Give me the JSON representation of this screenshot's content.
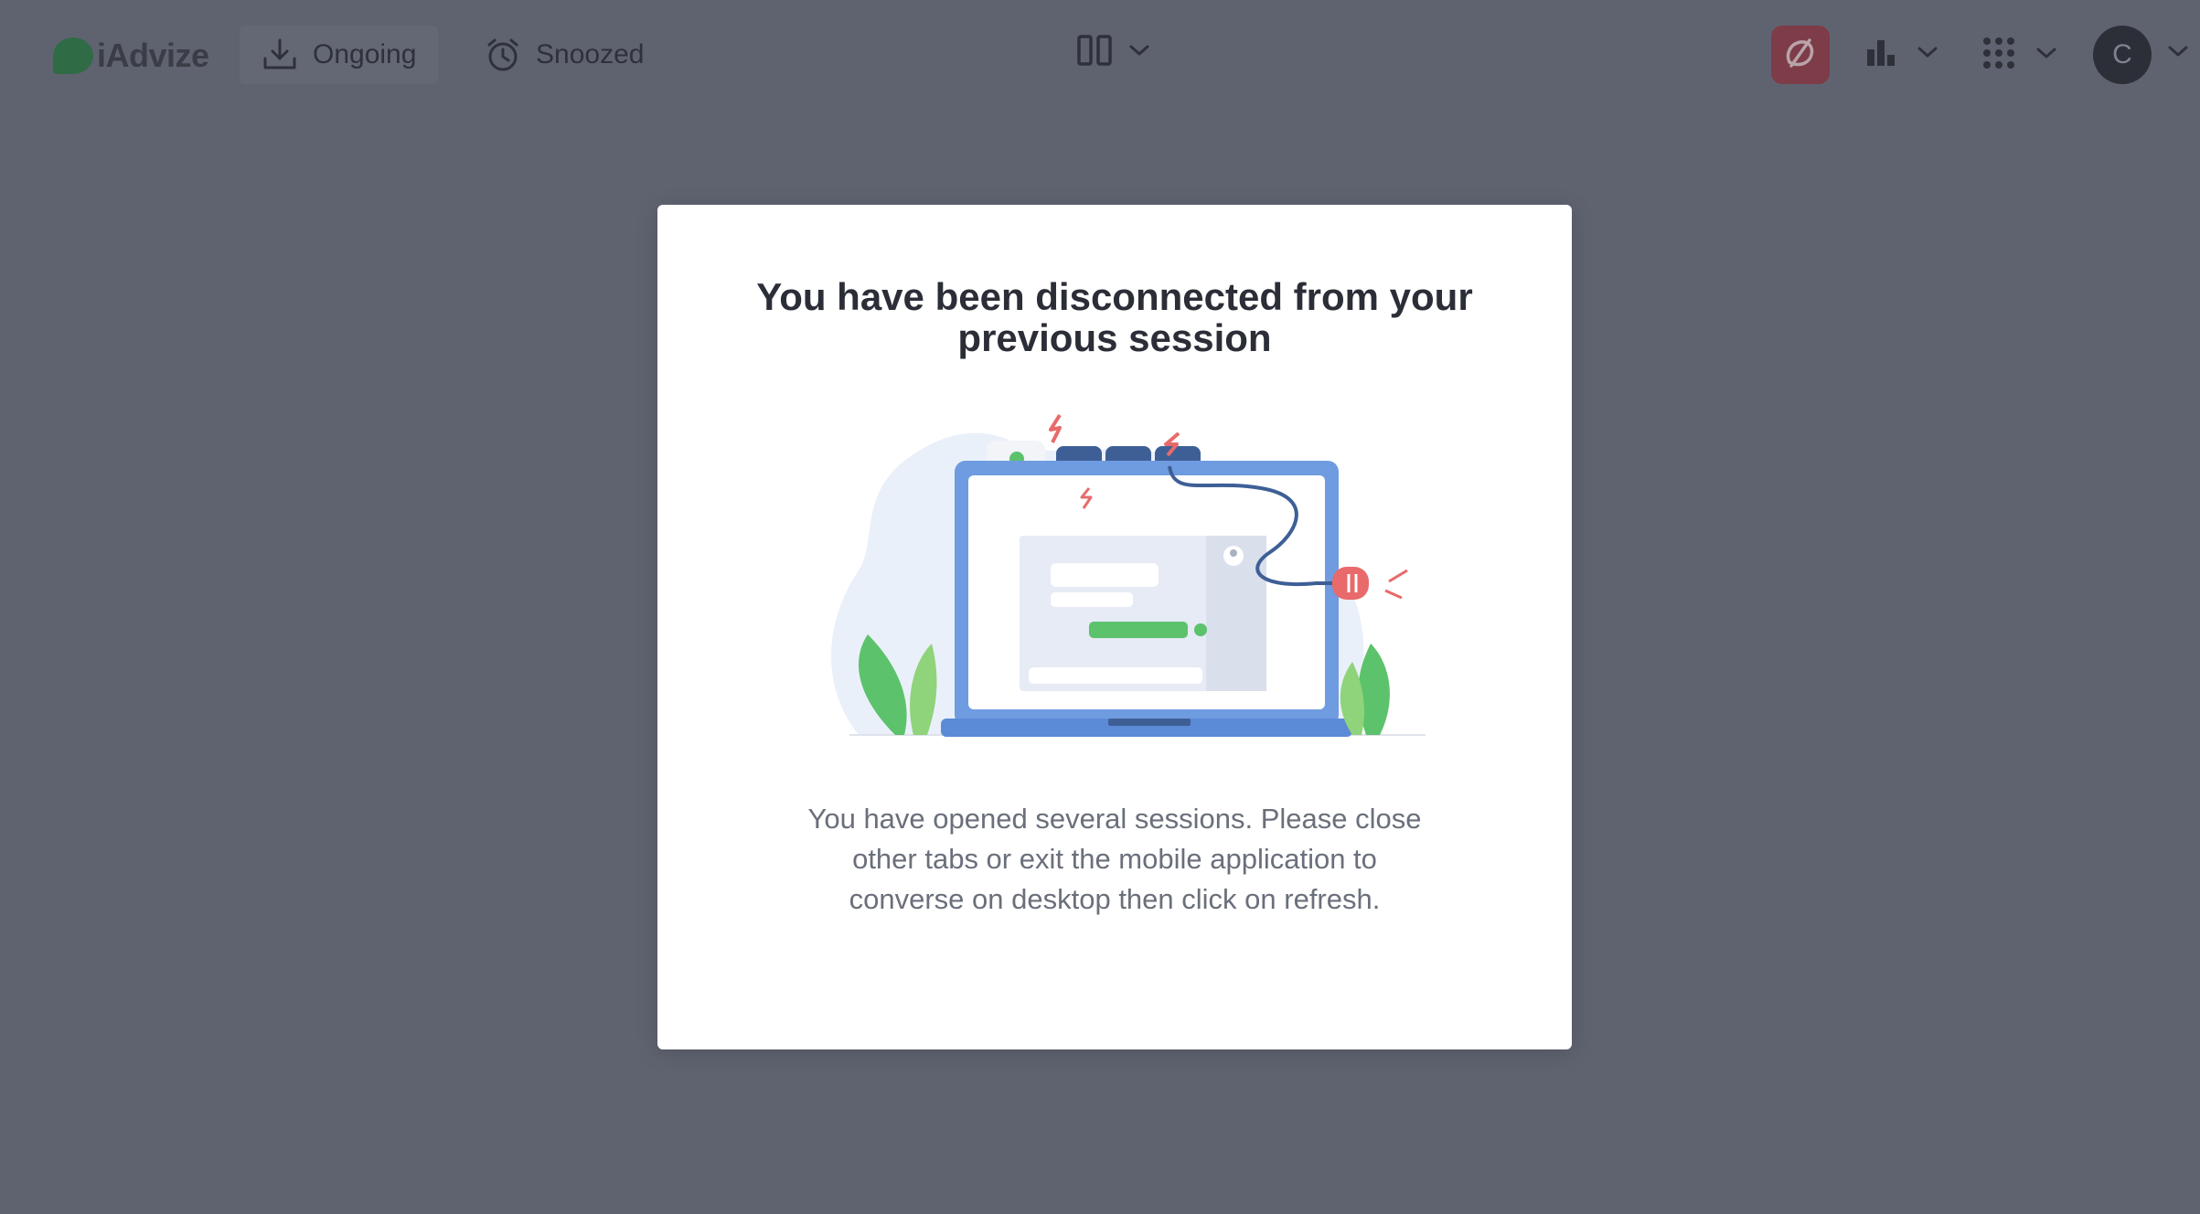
{
  "app": {
    "logo_text": "iAdvize"
  },
  "nav": {
    "ongoing_label": "Ongoing",
    "snoozed_label": "Snoozed"
  },
  "colors": {
    "background_overlay": "#5f6370",
    "status_button": "#7d3c48",
    "avatar": "#2c2f38",
    "brand_green": "#2f6b45"
  },
  "icons": {
    "ongoing": "inbox-download-icon",
    "snoozed": "alarm-clock-icon",
    "layout": "columns-layout-icon",
    "status": "unavailable-icon",
    "stats": "bar-chart-icon",
    "apps": "grid-apps-icon"
  },
  "user": {
    "initial": "C"
  },
  "modal": {
    "title": "You have been disconnected from your previous session",
    "body": "You have opened several sessions. Please close other tabs or exit the mobile application to converse on desktop then click on refresh."
  }
}
